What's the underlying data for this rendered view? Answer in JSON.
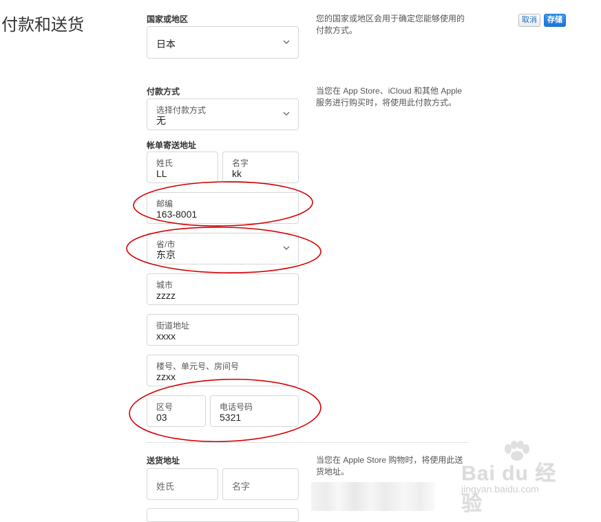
{
  "page": {
    "title": "付款和送货"
  },
  "actions": {
    "cancel_label": "取消",
    "save_label": "存储"
  },
  "country": {
    "section_label": "国家或地区",
    "selected": "日本",
    "help_text_line1": "您的国家或地区会用于确定您能够使用的",
    "help_text_line2": "付款方式。"
  },
  "payment": {
    "section_label": "付款方式",
    "select_label": "选择付款方式",
    "selected": "无",
    "help_text_line1": "当您在 App Store、iCloud 和其他 Apple",
    "help_text_line2": "服务进行购买时，将使用此付款方式。"
  },
  "billing": {
    "section_label": "帐单寄送地址",
    "last_name": {
      "label": "姓氏",
      "value": "LL"
    },
    "first_name": {
      "label": "名字",
      "value": "kk"
    },
    "postal_code": {
      "label": "邮编",
      "value": "163-8001"
    },
    "prefecture": {
      "label": "省/市",
      "value": "东京"
    },
    "city": {
      "label": "城市",
      "value": "zzzz"
    },
    "street": {
      "label": "街道地址",
      "value": "xxxx"
    },
    "building": {
      "label": "楼号、单元号、房间号",
      "value": "zzxx"
    },
    "area_code": {
      "label": "区号",
      "value": "03"
    },
    "phone": {
      "label": "电话号码",
      "value": "5321"
    }
  },
  "shipping": {
    "section_label": "送货地址",
    "last_name_placeholder": "姓氏",
    "first_name_placeholder": "名字",
    "help_text_line1": "当您在 Apple Store 购物时，将使用此送",
    "help_text_line2": "货地址。"
  },
  "watermark": {
    "brand": "Bai du 经验",
    "url": "jingyan.baidu.com"
  },
  "colors": {
    "accent": "#1a73d0",
    "annotation": "#d40000",
    "border": "#d6d6d6"
  },
  "icons": {
    "select_chevron": "chevron-down-icon",
    "watermark_logo": "paw-icon"
  }
}
